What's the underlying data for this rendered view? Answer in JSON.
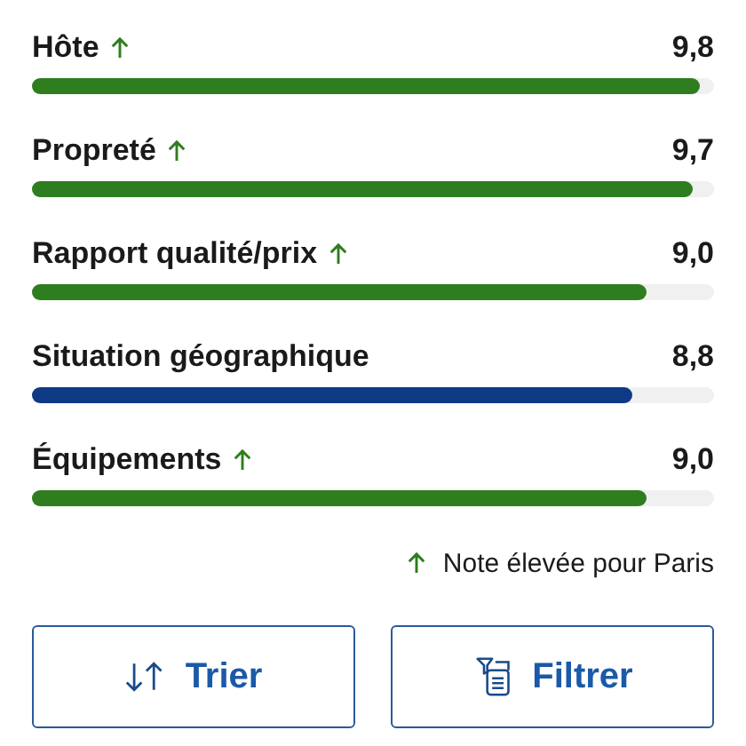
{
  "ratings": [
    {
      "label": "Hôte",
      "high": true,
      "score": "9,8",
      "level": 0.98
    },
    {
      "label": "Propreté",
      "high": true,
      "score": "9,7",
      "level": 0.97
    },
    {
      "label": "Rapport qualité/prix",
      "high": true,
      "score": "9,0",
      "level": 0.9
    },
    {
      "label": "Situation géographique",
      "high": false,
      "score": "8,8",
      "level": 0.88
    },
    {
      "label": "Équipements",
      "high": true,
      "score": "9,0",
      "level": 0.9
    }
  ],
  "legend": "Note élevée pour Paris",
  "buttons": [
    {
      "kind": "sort",
      "label": "Trier"
    },
    {
      "kind": "filter",
      "label": "Filtrer"
    }
  ]
}
